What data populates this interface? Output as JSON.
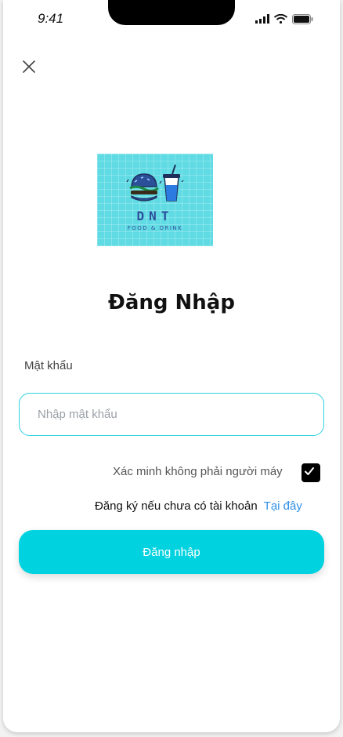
{
  "status_bar": {
    "time": "9:41"
  },
  "logo": {
    "title": "DNT",
    "subtitle": "FOOD & DRINK"
  },
  "page": {
    "title": "Đăng Nhập"
  },
  "password": {
    "label": "Mật khẩu",
    "placeholder": "Nhập mật khẩu",
    "value": ""
  },
  "verify": {
    "label": "Xác minh không phải người máy",
    "checked": true
  },
  "register": {
    "text": "Đăng ký nếu chưa có tài khoản",
    "link": "Tại đây"
  },
  "login_button": {
    "label": "Đăng nhập"
  },
  "colors": {
    "accent": "#00d2df",
    "link": "#2f8fe8",
    "input_border": "#2ed3df",
    "logo_bg": "#60dbe4"
  }
}
